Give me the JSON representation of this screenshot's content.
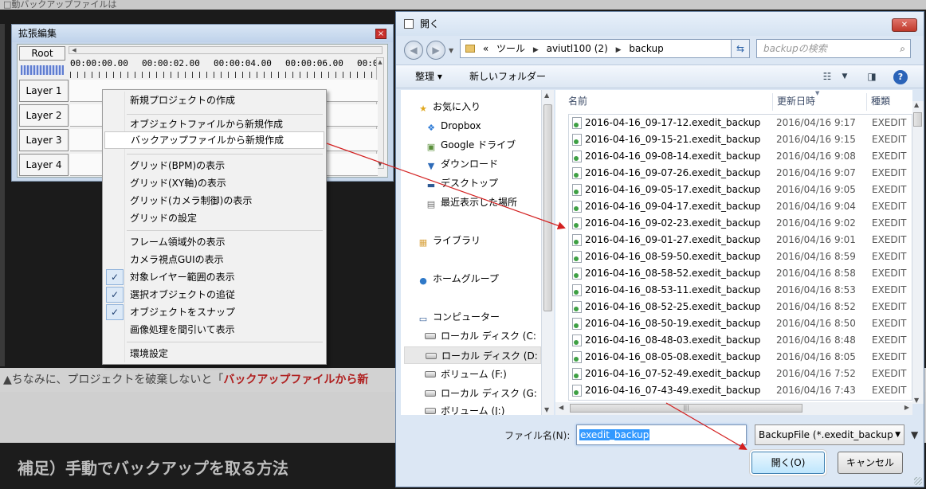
{
  "background": {
    "top_strip_text": "□動バックアップファイルは",
    "caption_prefix": "▲ちなみに、プロジェクトを破棄しないと「",
    "caption_bold": "バックアップファイルから新",
    "heading": "補足）手動でバックアップを取る方法"
  },
  "ext_edit": {
    "title": "拡張編集",
    "close_glyph": "×",
    "root_label": "Root",
    "times": [
      "00:00:00.00",
      "00:00:02.00",
      "00:00:04.00",
      "00:00:06.00",
      "00:0"
    ],
    "layers": [
      "Layer 1",
      "Layer 2",
      "Layer 3",
      "Layer 4"
    ]
  },
  "context_menu": {
    "items": [
      {
        "label": "新規プロジェクトの作成",
        "checked": false
      },
      {
        "label": "オブジェクトファイルから新規作成",
        "checked": false
      },
      {
        "label": "バックアップファイルから新規作成",
        "checked": false,
        "highlighted": true
      },
      {
        "label": "グリッド(BPM)の表示",
        "checked": false
      },
      {
        "label": "グリッド(XY軸)の表示",
        "checked": false
      },
      {
        "label": "グリッド(カメラ制御)の表示",
        "checked": false
      },
      {
        "label": "グリッドの設定",
        "checked": false
      },
      {
        "label": "フレーム領域外の表示",
        "checked": false
      },
      {
        "label": "カメラ視点GUIの表示",
        "checked": false
      },
      {
        "label": "対象レイヤー範囲の表示",
        "checked": true
      },
      {
        "label": "選択オブジェクトの追従",
        "checked": true
      },
      {
        "label": "オブジェクトをスナップ",
        "checked": true
      },
      {
        "label": "画像処理を間引いて表示",
        "checked": false
      },
      {
        "label": "環境設定",
        "checked": false
      }
    ],
    "check_glyph": "✓"
  },
  "dialog": {
    "title": "開く",
    "close_glyph": "✕",
    "address": {
      "overflow": "«",
      "segments": [
        "ツール",
        "aviutl100 (2)",
        "backup"
      ]
    },
    "search_placeholder": "backupの検索",
    "toolbar": {
      "organize": "整理 ▾",
      "new_folder": "新しいフォルダー",
      "help_glyph": "?"
    },
    "nav": [
      {
        "label": "お気に入り",
        "icon": "star-icon",
        "glyph": "★",
        "color": "#e0a81f"
      },
      {
        "label": "Dropbox",
        "icon": "dropbox-icon",
        "glyph": "❖",
        "color": "#2e7bd6"
      },
      {
        "label": "Google ドライブ",
        "icon": "google-drive-icon",
        "glyph": "▣",
        "color": "#5a8f3a"
      },
      {
        "label": "ダウンロード",
        "icon": "download-folder-icon",
        "glyph": "▼",
        "color": "#2e6bb8"
      },
      {
        "label": "デスクトップ",
        "icon": "desktop-icon",
        "glyph": "▬",
        "color": "#2e5a94"
      },
      {
        "label": "最近表示した場所",
        "icon": "recent-places-icon",
        "glyph": "▤",
        "color": "#6b6b6b"
      },
      {
        "label": "ライブラリ",
        "icon": "library-icon",
        "glyph": "▦",
        "color": "#d9a441"
      },
      {
        "label": "ホームグループ",
        "icon": "homegroup-icon",
        "glyph": "●",
        "color": "#2f79c8"
      },
      {
        "label": "コンピューター",
        "icon": "computer-icon",
        "glyph": "▭",
        "color": "#2e5a94"
      },
      {
        "label": "ローカル ディスク (C:",
        "icon": "disk-c-icon",
        "glyph": "",
        "color": "#777"
      },
      {
        "label": "ローカル ディスク (D:",
        "icon": "disk-d-icon",
        "glyph": "",
        "color": "#777"
      },
      {
        "label": "ボリューム (F:)",
        "icon": "disk-f-icon",
        "glyph": "",
        "color": "#777"
      },
      {
        "label": "ローカル ディスク (G:",
        "icon": "disk-g-icon",
        "glyph": "",
        "color": "#777"
      },
      {
        "label": "ボリューム (J:)",
        "icon": "disk-j-icon",
        "glyph": "",
        "color": "#777"
      }
    ],
    "columns": {
      "name": "名前",
      "date": "更新日時",
      "type": "種類"
    },
    "files": [
      {
        "name": "2016-04-16_09-17-12.exedit_backup",
        "date": "2016/04/16 9:17",
        "type": "EXEDIT"
      },
      {
        "name": "2016-04-16_09-15-21.exedit_backup",
        "date": "2016/04/16 9:15",
        "type": "EXEDIT"
      },
      {
        "name": "2016-04-16_09-08-14.exedit_backup",
        "date": "2016/04/16 9:08",
        "type": "EXEDIT"
      },
      {
        "name": "2016-04-16_09-07-26.exedit_backup",
        "date": "2016/04/16 9:07",
        "type": "EXEDIT"
      },
      {
        "name": "2016-04-16_09-05-17.exedit_backup",
        "date": "2016/04/16 9:05",
        "type": "EXEDIT"
      },
      {
        "name": "2016-04-16_09-04-17.exedit_backup",
        "date": "2016/04/16 9:04",
        "type": "EXEDIT"
      },
      {
        "name": "2016-04-16_09-02-23.exedit_backup",
        "date": "2016/04/16 9:02",
        "type": "EXEDIT"
      },
      {
        "name": "2016-04-16_09-01-27.exedit_backup",
        "date": "2016/04/16 9:01",
        "type": "EXEDIT"
      },
      {
        "name": "2016-04-16_08-59-50.exedit_backup",
        "date": "2016/04/16 8:59",
        "type": "EXEDIT"
      },
      {
        "name": "2016-04-16_08-58-52.exedit_backup",
        "date": "2016/04/16 8:58",
        "type": "EXEDIT"
      },
      {
        "name": "2016-04-16_08-53-11.exedit_backup",
        "date": "2016/04/16 8:53",
        "type": "EXEDIT"
      },
      {
        "name": "2016-04-16_08-52-25.exedit_backup",
        "date": "2016/04/16 8:52",
        "type": "EXEDIT"
      },
      {
        "name": "2016-04-16_08-50-19.exedit_backup",
        "date": "2016/04/16 8:50",
        "type": "EXEDIT"
      },
      {
        "name": "2016-04-16_08-48-03.exedit_backup",
        "date": "2016/04/16 8:48",
        "type": "EXEDIT"
      },
      {
        "name": "2016-04-16_08-05-08.exedit_backup",
        "date": "2016/04/16 8:05",
        "type": "EXEDIT"
      },
      {
        "name": "2016-04-16_07-52-49.exedit_backup",
        "date": "2016/04/16 7:52",
        "type": "EXEDIT"
      },
      {
        "name": "2016-04-16_07-43-49.exedit_backup",
        "date": "2016/04/16 7:43",
        "type": "EXEDIT"
      }
    ],
    "filename_label": "ファイル名(N):",
    "filename_value": "exedit_backup",
    "filetype_value": "BackupFile (*.exedit_backup",
    "open_button": "開く(O)",
    "cancel_button": "キャンセル"
  },
  "colors": {
    "annotation_arrow": "#d32020",
    "highlight_selection": "#3399ff"
  }
}
